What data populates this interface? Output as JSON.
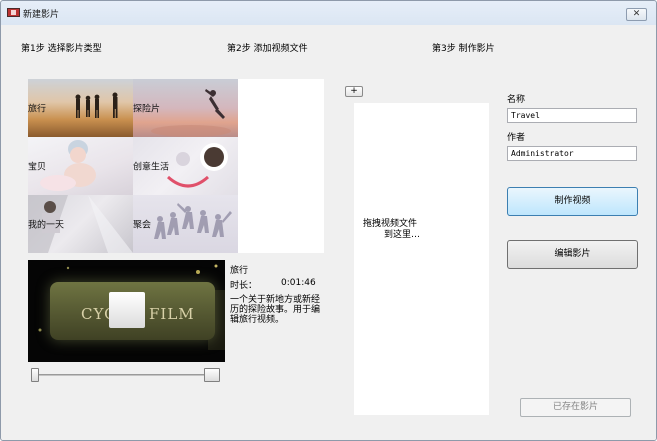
{
  "window": {
    "title": "新建影片",
    "close_label": "✕"
  },
  "steps": {
    "step1": "第1步  选择影片类型",
    "step2": "第2步  添加视频文件",
    "step3": "第3步  制作影片"
  },
  "categories": [
    {
      "label": "旅行"
    },
    {
      "label": "探险片"
    },
    {
      "label": "宝贝"
    },
    {
      "label": "创意生活"
    },
    {
      "label": "我的一天"
    },
    {
      "label": "聚会"
    }
  ],
  "preview": {
    "sign_left": "CYC",
    "sign_right": "FILM",
    "name": "旅行",
    "duration_label": "时长：",
    "duration_value": "0:01:46",
    "description": "一个关于新地方或新经历的探险故事。用于编辑旅行视频。"
  },
  "add": {
    "label": "+"
  },
  "drop": {
    "line1": "拖拽视频文件",
    "line2": "到这里…"
  },
  "form": {
    "name_label": "名称",
    "name_value": "Travel",
    "author_label": "作者",
    "author_value": "Administrator"
  },
  "buttons": {
    "make": "制作视频",
    "edit": "编辑影片",
    "existing": "已存在影片"
  },
  "colors": {
    "accent_border": "#3c7fb1",
    "accent_fill": "#bee6fd",
    "window_bg": "#f0f0f0"
  }
}
